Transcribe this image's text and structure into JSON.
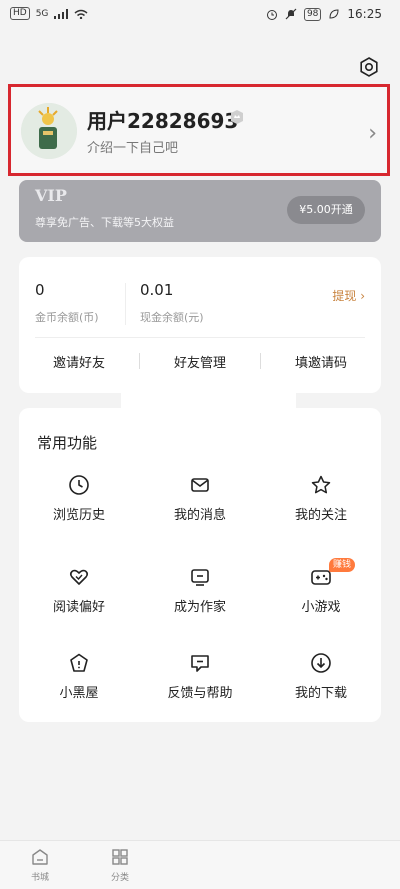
{
  "status_bar": {
    "left": [
      "HD",
      "5G",
      "signal-icon",
      "wifi-icon"
    ],
    "battery": "98",
    "time": "16:25"
  },
  "profile": {
    "username": "用户22828693",
    "bio": "介绍一下自己吧"
  },
  "vip": {
    "title": "VIP",
    "desc": "尊享免广告、下载等5大权益",
    "button": "¥5.00开通"
  },
  "wallet": {
    "coins_value": "0",
    "coins_label": "金币余额(币)",
    "cash_value": "0.01",
    "cash_label": "现金余额(元)",
    "withdraw": "提现",
    "actions": [
      "邀请好友",
      "好友管理",
      "填邀请码"
    ]
  },
  "features": {
    "title": "常用功能",
    "items": [
      {
        "label": "浏览历史",
        "icon": "clock-icon"
      },
      {
        "label": "我的消息",
        "icon": "message-icon"
      },
      {
        "label": "我的关注",
        "icon": "star-icon"
      },
      {
        "label": "阅读偏好",
        "icon": "heart-icon"
      },
      {
        "label": "成为作家",
        "icon": "write-icon"
      },
      {
        "label": "小游戏",
        "icon": "gamepad-icon",
        "badge": "赚钱"
      },
      {
        "label": "小黑屋",
        "icon": "blocklist-icon"
      },
      {
        "label": "反馈与帮助",
        "icon": "feedback-icon"
      },
      {
        "label": "我的下载",
        "icon": "download-icon"
      }
    ]
  },
  "bottom_nav": [
    {
      "label": "书城",
      "icon": "bookstore-icon"
    },
    {
      "label": "分类",
      "icon": "category-icon"
    }
  ],
  "colors": {
    "highlight_border": "#d7272f",
    "withdraw": "#c8833f",
    "badge": "#ff7a3d"
  }
}
